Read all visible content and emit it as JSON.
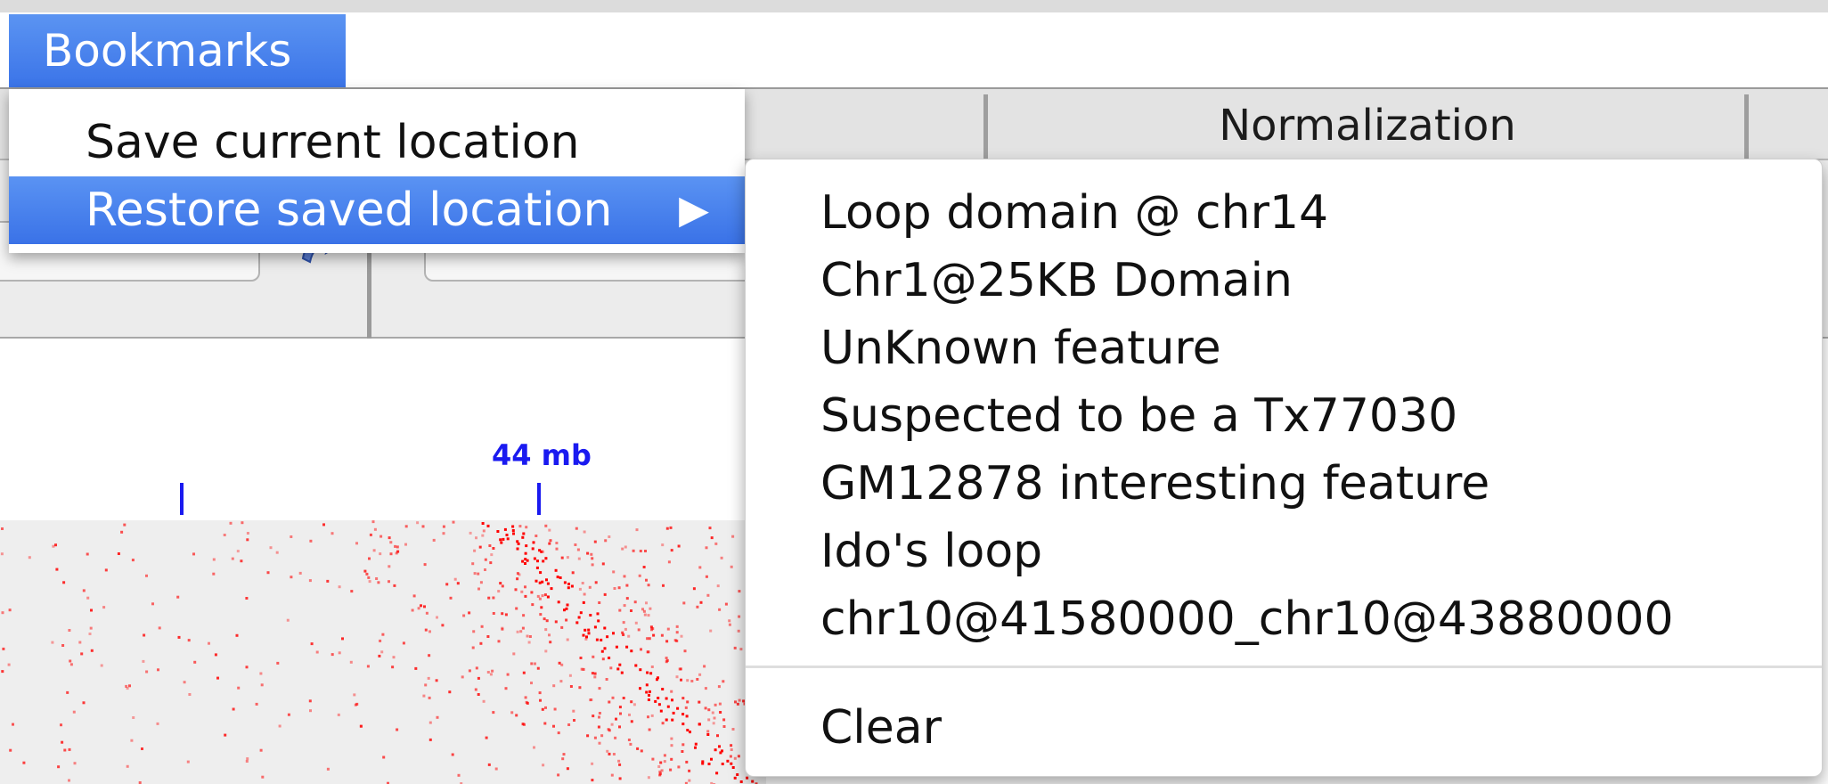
{
  "menubar": {
    "active_menu": "Bookmarks"
  },
  "toolbar": {
    "normalization_header": "Normalization"
  },
  "ruler": {
    "label": "44 mb"
  },
  "bookmarks_menu": {
    "items": [
      {
        "label": "Save current location"
      },
      {
        "label": "Restore saved location",
        "has_submenu": true
      }
    ]
  },
  "saved_locations": {
    "items": [
      "Loop domain @ chr14",
      "Chr1@25KB Domain",
      "UnKnown feature",
      "Suspected to be a Tx77030",
      "GM12878 interesting feature",
      "Ido's loop",
      "chr10@41580000_chr10@43880000"
    ],
    "clear_label": "Clear"
  },
  "colors": {
    "menu_highlight": "#3b74e8",
    "heatmap": "#ff0000",
    "ruler": "#1a1af0"
  }
}
